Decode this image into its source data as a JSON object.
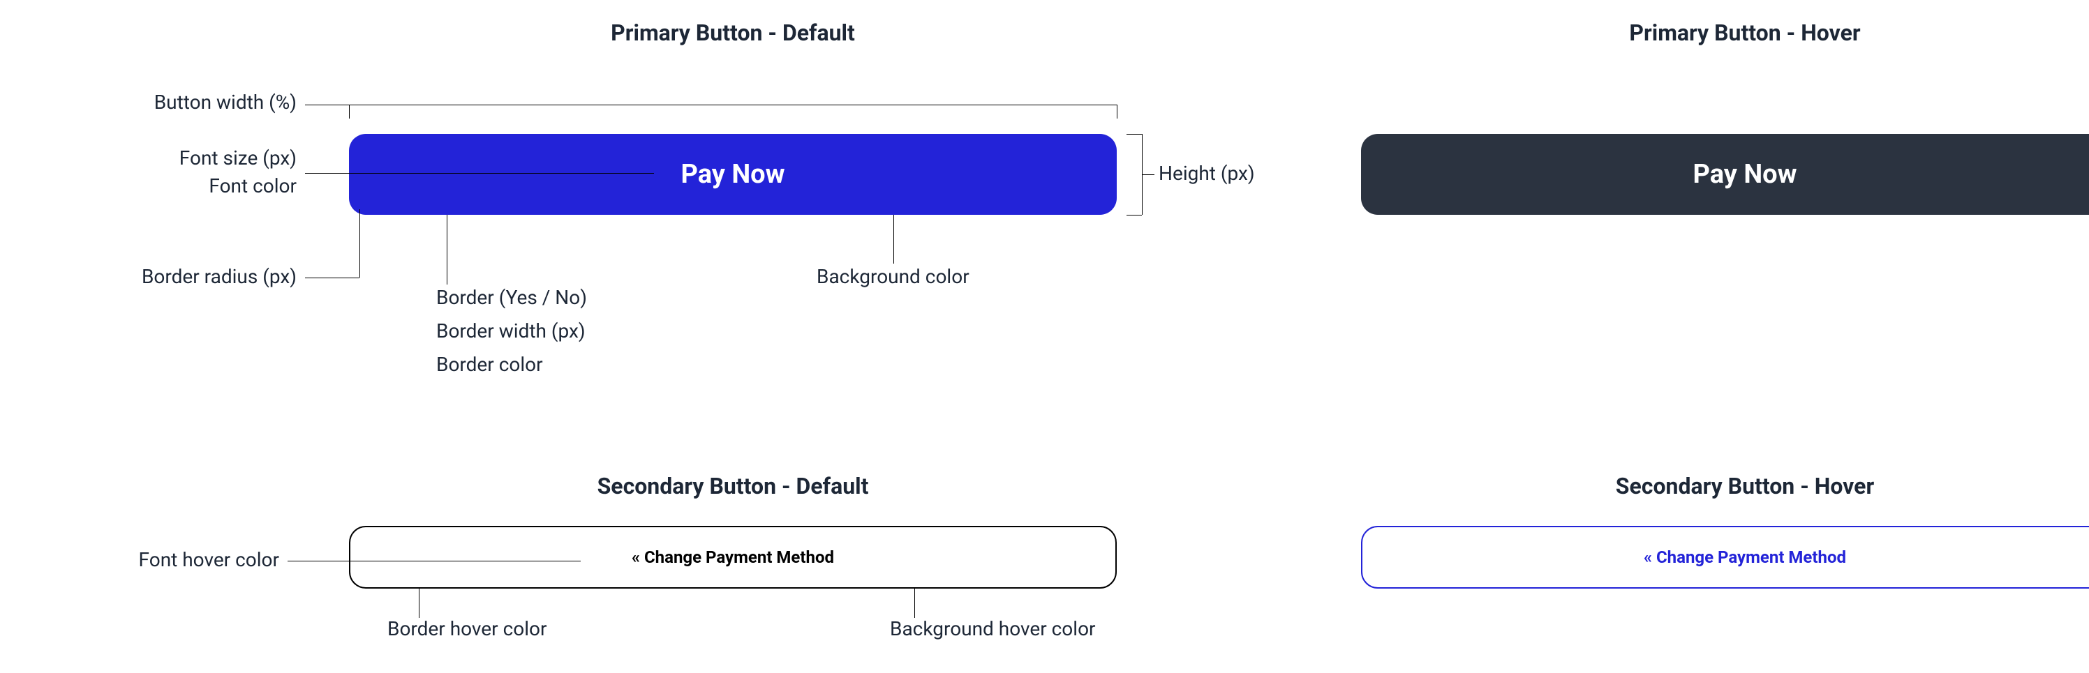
{
  "titles": {
    "primary_default": "Primary Button - Default",
    "primary_hover": "Primary Button - Hover",
    "secondary_default": "Secondary Button - Default",
    "secondary_hover": "Secondary Button - Hover"
  },
  "buttons": {
    "primary_default_label": "Pay Now",
    "primary_hover_label": "Pay Now",
    "secondary_default_label": "« Change Payment Method",
    "secondary_hover_label": "« Change Payment Method"
  },
  "annotations": {
    "button_width": "Button width (%)",
    "font_size": "Font size (px)",
    "font_color": "Font color",
    "border_radius": "Border radius (px)",
    "border_yesno": "Border (Yes / No)",
    "border_width": "Border width (px)",
    "border_color": "Border color",
    "background_color": "Background color",
    "height": "Height (px)",
    "font_hover_color": "Font hover color",
    "border_hover_color": "Border hover color",
    "background_hover_color": "Background hover color"
  }
}
